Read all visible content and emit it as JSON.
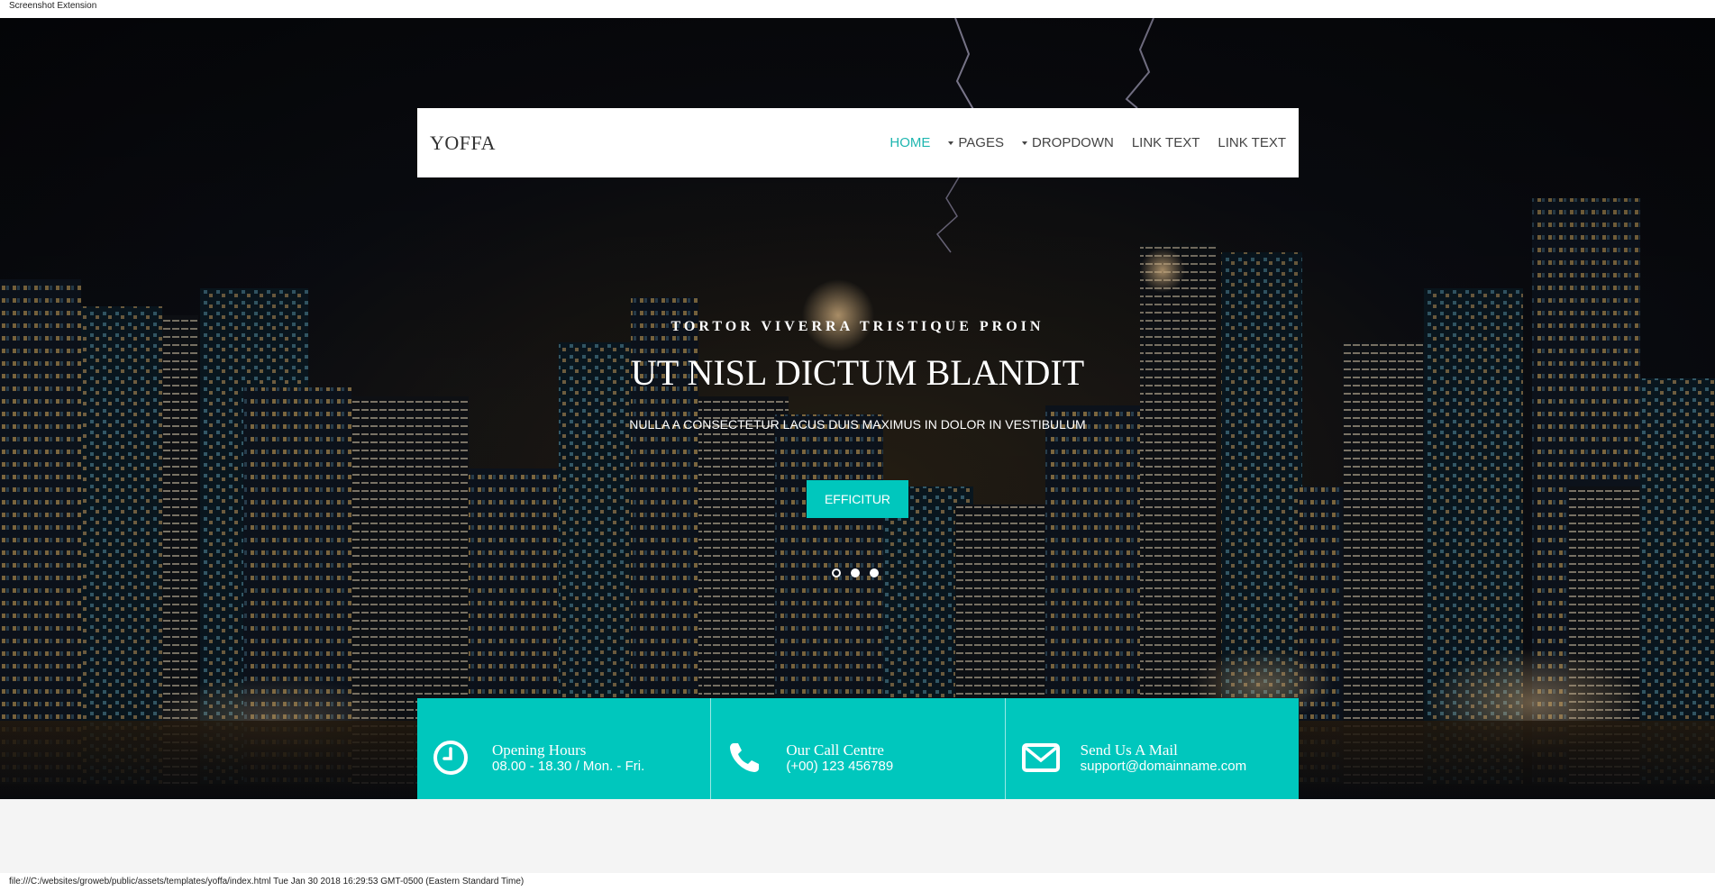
{
  "extension_bar": {
    "label": "Screenshot Extension"
  },
  "navbar": {
    "brand": "YOFFA",
    "items": [
      {
        "label": "HOME",
        "active": true,
        "dropdown": false
      },
      {
        "label": "PAGES",
        "active": false,
        "dropdown": true
      },
      {
        "label": "DROPDOWN",
        "active": false,
        "dropdown": true
      },
      {
        "label": "LINK TEXT",
        "active": false,
        "dropdown": false
      },
      {
        "label": "LINK TEXT",
        "active": false,
        "dropdown": false
      }
    ]
  },
  "hero": {
    "kicker": "TORTOR VIVERRA TRISTIQUE PROIN",
    "headline": "UT NISL DICTUM BLANDIT",
    "subline": "NULLA A CONSECTETUR LACUS DUIS MAXIMUS IN DOLOR IN VESTIBULUM",
    "cta_label": "EFFICITUR",
    "slides": {
      "count": 3,
      "active_index": 0
    }
  },
  "info": [
    {
      "icon": "clock-icon",
      "title": "Opening Hours",
      "text": "08.00 - 18.30 / Mon. - Fri."
    },
    {
      "icon": "phone-icon",
      "title": "Our Call Centre",
      "text": "(+00) 123 456789"
    },
    {
      "icon": "mail-icon",
      "title": "Send Us A Mail",
      "text": "support@domainname.com"
    }
  ],
  "footer_line": "file:///C:/websites/groweb/public/assets/templates/yoffa/index.html Tue Jan 30 2018 16:29:53 GMT-0500 (Eastern Standard Time)",
  "colors": {
    "accent": "#00c7bd",
    "nav_active": "#1fb6b0",
    "nav_text": "#444444",
    "page_below": "#f4f4f4"
  }
}
